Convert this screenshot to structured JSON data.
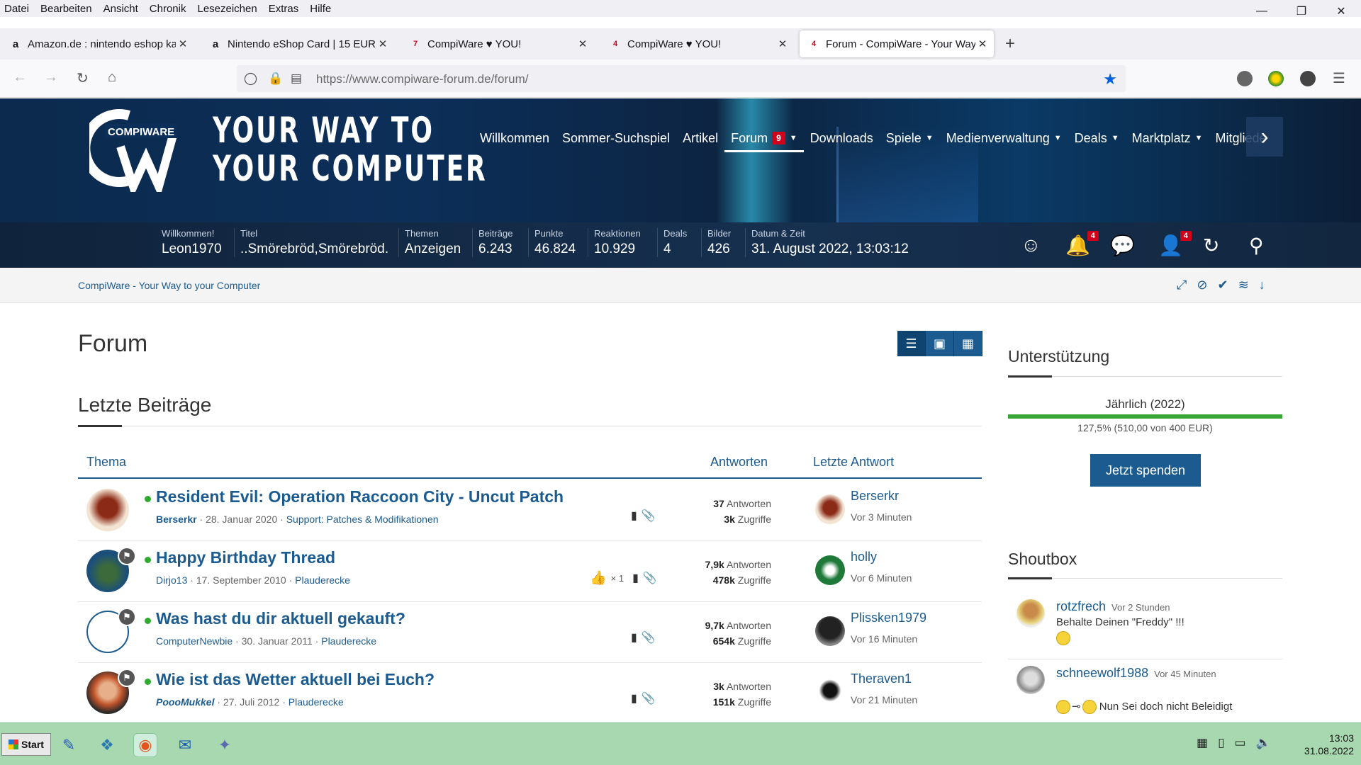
{
  "menubar": [
    "Datei",
    "Bearbeiten",
    "Ansicht",
    "Chronik",
    "Lesezeichen",
    "Extras",
    "Hilfe"
  ],
  "tabs": [
    {
      "title": "Amazon.de : nintendo eshop ka",
      "favicon": "a"
    },
    {
      "title": "Nintendo eShop Card | 15 EUR (",
      "favicon": "a"
    },
    {
      "title": "CompiWare ♥ YOU!",
      "favicon": "7"
    },
    {
      "title": "CompiWare ♥ YOU!",
      "favicon": "4"
    },
    {
      "title": "Forum - CompiWare - Your Way",
      "favicon": "4"
    }
  ],
  "url": "https://www.compiware-forum.de/forum/",
  "logo_text": "COMPIWARE",
  "slogan": [
    "YOUR WAY TO",
    "YOUR COMPUTER"
  ],
  "nav": {
    "items": [
      "Willkommen",
      "Sommer-Suchspiel",
      "Artikel",
      "Forum",
      "Downloads",
      "Spiele",
      "Medienverwaltung",
      "Deals",
      "Marktplatz",
      "Mitgliede"
    ],
    "forum_badge": "9"
  },
  "stats": [
    {
      "label": "Willkommen!",
      "value": "Leon1970"
    },
    {
      "label": "Titel",
      "value": "..Smörebröd,Smörebröd."
    },
    {
      "label": "Themen",
      "value": "Anzeigen"
    },
    {
      "label": "Beiträge",
      "value": "6.243"
    },
    {
      "label": "Punkte",
      "value": "46.824"
    },
    {
      "label": "Reaktionen",
      "value": "10.929"
    },
    {
      "label": "Deals",
      "value": "4"
    },
    {
      "label": "Bilder",
      "value": "426"
    },
    {
      "label": "Datum & Zeit",
      "value": "31. August 2022, 13:03:12"
    }
  ],
  "badges": {
    "notifications": "4",
    "friends": "4"
  },
  "breadcrumb": "CompiWare - Your Way to your Computer",
  "page_title": "Forum",
  "section_title": "Letzte Beiträge",
  "table_headers": {
    "thema": "Thema",
    "antworten": "Antworten",
    "letzte": "Letzte Antwort"
  },
  "threads": [
    {
      "title": "Resident Evil: Operation Raccoon City - Uncut Patch",
      "author": "Berserkr",
      "date": "28. Januar 2020",
      "forum": "Support: Patches & Modifikationen",
      "replies": "37",
      "replies_label": "Antworten",
      "views": "3k",
      "views_label": "Zugriffe",
      "last_user": "Berserkr",
      "last_time": "Vor 3 Minuten"
    },
    {
      "title": "Happy Birthday Thread",
      "author": "Dirjo13",
      "date": "17. September 2010",
      "forum": "Plauderecke",
      "likes": "× 1",
      "replies": "7,9k",
      "replies_label": "Antworten",
      "views": "478k",
      "views_label": "Zugriffe",
      "last_user": "holly",
      "last_time": "Vor 6 Minuten"
    },
    {
      "title": "Was hast du dir aktuell gekauft?",
      "author": "ComputerNewbie",
      "date": "30. Januar 2011",
      "forum": "Plauderecke",
      "replies": "9,7k",
      "replies_label": "Antworten",
      "views": "654k",
      "views_label": "Zugriffe",
      "last_user": "Plissken1979",
      "last_time": "Vor 16 Minuten"
    },
    {
      "title": "Wie ist das Wetter aktuell bei Euch?",
      "author": "PoooMukkel",
      "date": "27. Juli 2012",
      "forum": "Plauderecke",
      "replies": "3k",
      "replies_label": "Antworten",
      "views": "151k",
      "views_label": "Zugriffe",
      "last_user": "Theraven1",
      "last_time": "Vor 21 Minuten"
    }
  ],
  "sidebar": {
    "support_title": "Unterstützung",
    "donation_title": "Jährlich (2022)",
    "donation_progress": "127,5% (510,00 von 400 EUR)",
    "donation_button": "Jetzt spenden",
    "shoutbox_title": "Shoutbox",
    "shouts": [
      {
        "user": "rotzfrech",
        "time": "Vor 2 Stunden",
        "message": "Behalte Deinen \"Freddy\" !!!"
      },
      {
        "user": "schneewolf1988",
        "time": "Vor 45 Minuten",
        "message": "Nun Sei doch nicht Beleidigt"
      }
    ]
  },
  "taskbar": {
    "start": "Start",
    "time": "13:03",
    "date": "31.08.2022"
  },
  "colors": {
    "accent": "#1c5b8f",
    "banner": "#0c2f59",
    "taskbar": "#a8d8b0",
    "online": "#2eaa2e",
    "badge": "#d0021b"
  }
}
